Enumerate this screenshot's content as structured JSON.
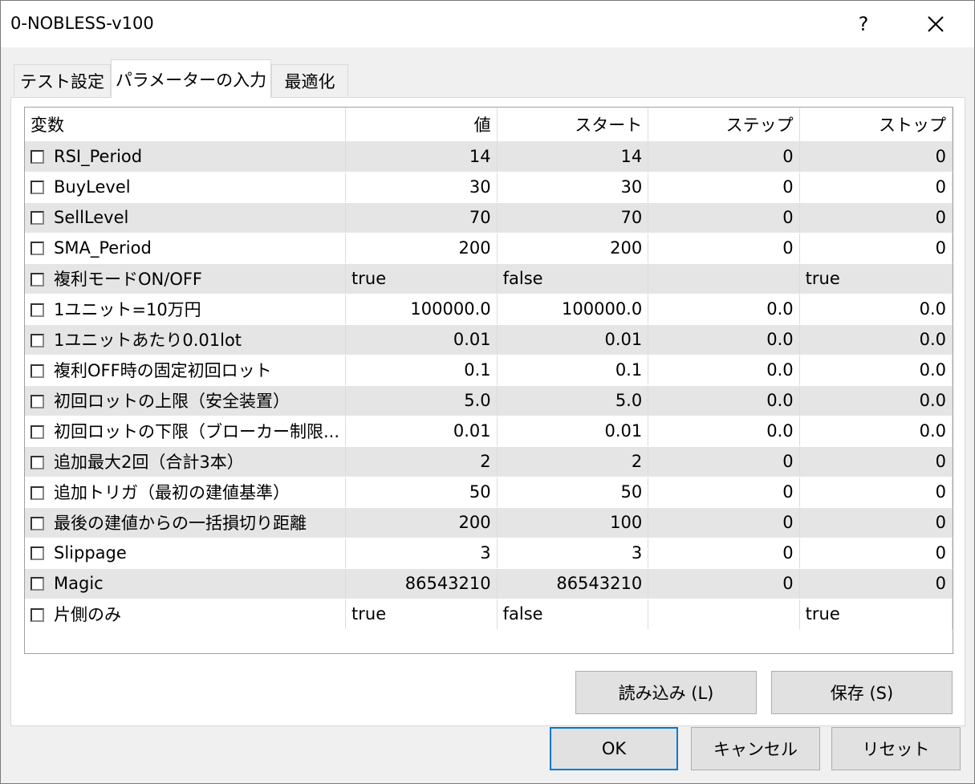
{
  "window": {
    "title": "0-NOBLESS-v100",
    "help_label": "?"
  },
  "tabs": [
    {
      "label": "テスト設定"
    },
    {
      "label": "パラメーターの入力"
    },
    {
      "label": "最適化"
    }
  ],
  "table": {
    "headers": [
      "変数",
      "値",
      "スタート",
      "ステップ",
      "ストップ"
    ],
    "rows": [
      {
        "name": "RSI_Period",
        "value": "14",
        "start": "14",
        "step": "0",
        "stop": "0"
      },
      {
        "name": "BuyLevel",
        "value": "30",
        "start": "30",
        "step": "0",
        "stop": "0"
      },
      {
        "name": "SellLevel",
        "value": "70",
        "start": "70",
        "step": "0",
        "stop": "0"
      },
      {
        "name": "SMA_Period",
        "value": "200",
        "start": "200",
        "step": "0",
        "stop": "0"
      },
      {
        "name": "複利モードON/OFF",
        "value": "true",
        "start": "false",
        "step": "",
        "stop": "true"
      },
      {
        "name": "1ユニット=10万円",
        "value": "100000.0",
        "start": "100000.0",
        "step": "0.0",
        "stop": "0.0"
      },
      {
        "name": "1ユニットあたり0.01lot",
        "value": "0.01",
        "start": "0.01",
        "step": "0.0",
        "stop": "0.0"
      },
      {
        "name": "複利OFF時の固定初回ロット",
        "value": "0.1",
        "start": "0.1",
        "step": "0.0",
        "stop": "0.0"
      },
      {
        "name": "初回ロットの上限（安全装置）",
        "value": "5.0",
        "start": "5.0",
        "step": "0.0",
        "stop": "0.0"
      },
      {
        "name": "初回ロットの下限（ブローカー制限...",
        "value": "0.01",
        "start": "0.01",
        "step": "0.0",
        "stop": "0.0"
      },
      {
        "name": "追加最大2回（合計3本）",
        "value": "2",
        "start": "2",
        "step": "0",
        "stop": "0"
      },
      {
        "name": "追加トリガ（最初の建値基準）",
        "value": "50",
        "start": "50",
        "step": "0",
        "stop": "0"
      },
      {
        "name": "最後の建値からの一括損切り距離",
        "value": "200",
        "start": "100",
        "step": "0",
        "stop": "0"
      },
      {
        "name": "Slippage",
        "value": "3",
        "start": "3",
        "step": "0",
        "stop": "0"
      },
      {
        "name": "Magic",
        "value": "86543210",
        "start": "86543210",
        "step": "0",
        "stop": "0"
      },
      {
        "name": "片側のみ",
        "value": "true",
        "start": "false",
        "step": "",
        "stop": "true"
      }
    ]
  },
  "buttons": {
    "load": "読み込み (L)",
    "save": "保存 (S)",
    "ok": "OK",
    "cancel": "キャンセル",
    "reset": "リセット"
  }
}
